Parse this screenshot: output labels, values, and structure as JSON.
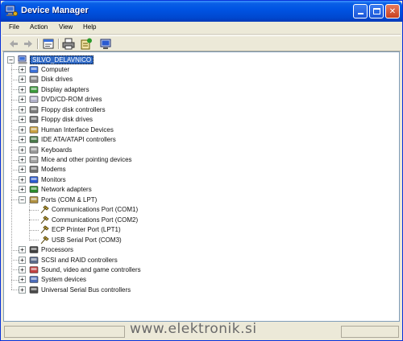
{
  "window": {
    "title": "Device Manager"
  },
  "menu": [
    "File",
    "Action",
    "View",
    "Help"
  ],
  "toolbar": {
    "buttons": [
      "back-icon",
      "forward-icon",
      "properties-view-icon",
      "print-icon",
      "help-properties-icon",
      "scan-hardware-icon"
    ]
  },
  "tree": {
    "root": "SILVO_DELAVNICO",
    "items": [
      {
        "label": "Computer",
        "icon": "computer-icon",
        "expanded": false
      },
      {
        "label": "Disk drives",
        "icon": "disk-drive-icon",
        "expanded": false
      },
      {
        "label": "Display adapters",
        "icon": "display-adapter-icon",
        "expanded": false
      },
      {
        "label": "DVD/CD-ROM drives",
        "icon": "cdrom-icon",
        "expanded": false
      },
      {
        "label": "Floppy disk controllers",
        "icon": "floppy-controller-icon",
        "expanded": false
      },
      {
        "label": "Floppy disk drives",
        "icon": "floppy-drive-icon",
        "expanded": false
      },
      {
        "label": "Human Interface Devices",
        "icon": "hid-icon",
        "expanded": false
      },
      {
        "label": "IDE ATA/ATAPI controllers",
        "icon": "ide-controller-icon",
        "expanded": false
      },
      {
        "label": "Keyboards",
        "icon": "keyboard-icon",
        "expanded": false
      },
      {
        "label": "Mice and other pointing devices",
        "icon": "mouse-icon",
        "expanded": false
      },
      {
        "label": "Modems",
        "icon": "modem-icon",
        "expanded": false
      },
      {
        "label": "Monitors",
        "icon": "monitor-icon",
        "expanded": false
      },
      {
        "label": "Network adapters",
        "icon": "network-adapter-icon",
        "expanded": false
      },
      {
        "label": "Ports (COM & LPT)",
        "icon": "port-icon",
        "expanded": true,
        "children": [
          "Communications Port (COM1)",
          "Communications Port (COM2)",
          "ECP Printer Port (LPT1)",
          "USB Serial Port (COM3)"
        ]
      },
      {
        "label": "Processors",
        "icon": "processor-icon",
        "expanded": false
      },
      {
        "label": "SCSI and RAID controllers",
        "icon": "scsi-icon",
        "expanded": false
      },
      {
        "label": "Sound, video and game controllers",
        "icon": "sound-icon",
        "expanded": false
      },
      {
        "label": "System devices",
        "icon": "system-device-icon",
        "expanded": false
      },
      {
        "label": "Universal Serial Bus controllers",
        "icon": "usb-icon",
        "expanded": false
      }
    ]
  },
  "watermark": "www.elektronik.si",
  "colors": {
    "titlebar": "#0054e3",
    "selection": "#316ac5",
    "chrome": "#ece9d8"
  }
}
